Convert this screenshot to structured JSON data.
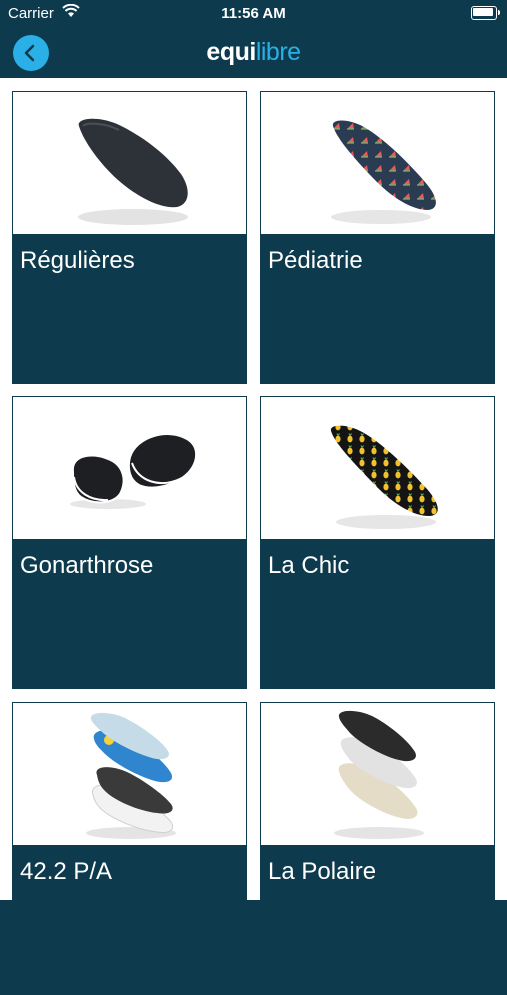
{
  "status_bar": {
    "carrier": "Carrier",
    "time": "11:56 AM"
  },
  "header": {
    "logo_part1": "equi",
    "logo_part2": "libre"
  },
  "products": [
    {
      "label": "Régulières"
    },
    {
      "label": "Pédiatrie"
    },
    {
      "label": "Gonarthrose"
    },
    {
      "label": "La Chic"
    },
    {
      "label": "42.2 P/A"
    },
    {
      "label": "La Polaire"
    }
  ],
  "colors": {
    "primary": "#0d3a4c",
    "accent": "#2ab0e6"
  }
}
